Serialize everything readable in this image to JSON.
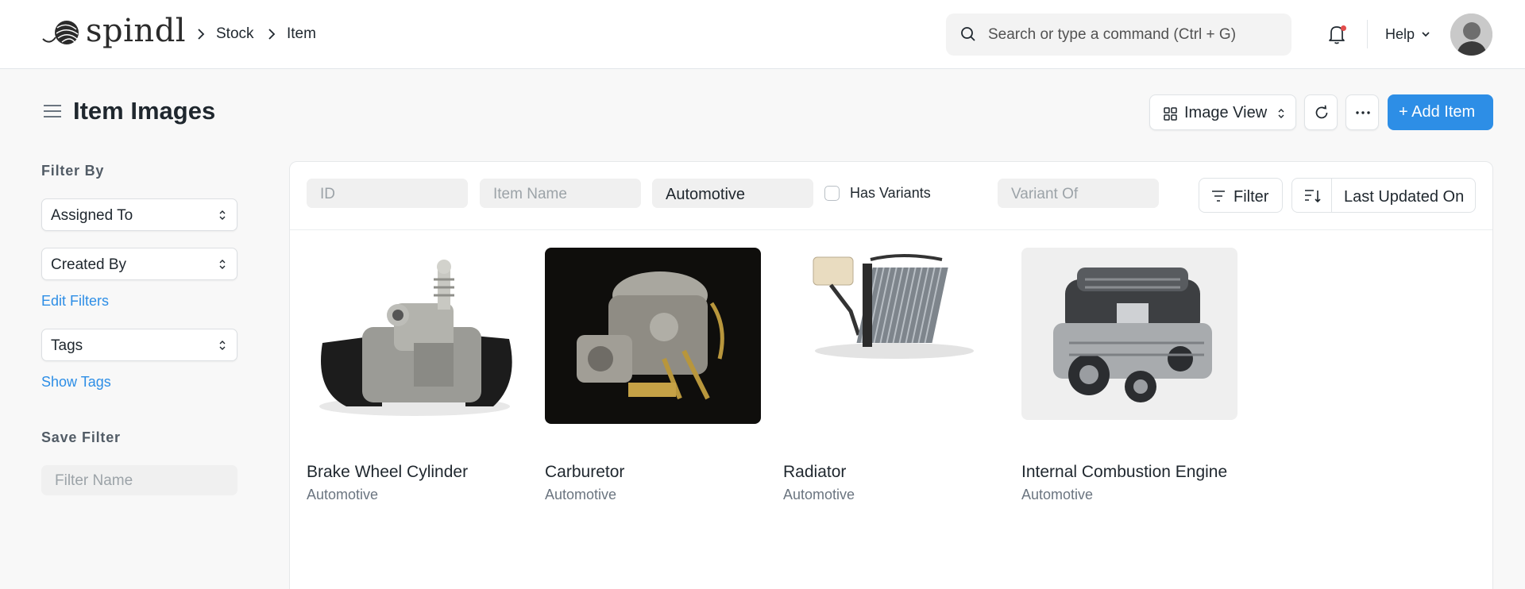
{
  "app": {
    "logo_text": "spindl"
  },
  "breadcrumbs": [
    "Stock",
    "Item"
  ],
  "search": {
    "placeholder": "Search or type a command (Ctrl + G)"
  },
  "navbar": {
    "help_label": "Help"
  },
  "page": {
    "title": "Item Images"
  },
  "toolbar": {
    "view_label": "Image View",
    "add_label": "+ Add Item"
  },
  "sidebar": {
    "filter_by_heading": "Filter By",
    "assigned_to": "Assigned To",
    "created_by": "Created By",
    "edit_filters": "Edit Filters",
    "tags": "Tags",
    "show_tags": "Show Tags",
    "save_filter_heading": "Save Filter",
    "filter_name_placeholder": "Filter Name"
  },
  "filters": {
    "id_placeholder": "ID",
    "item_name_placeholder": "Item Name",
    "item_group_value": "Automotive",
    "has_variants_label": "Has Variants",
    "variant_of_placeholder": "Variant Of",
    "filter_button": "Filter",
    "sort_label": "Last Updated On"
  },
  "items": [
    {
      "name": "Brake Wheel Cylinder",
      "group": "Automotive",
      "image": "brake-wheel-cylinder"
    },
    {
      "name": "Carburetor",
      "group": "Automotive",
      "image": "carburetor"
    },
    {
      "name": "Radiator",
      "group": "Automotive",
      "image": "radiator"
    },
    {
      "name": "Internal Combustion Engine",
      "group": "Automotive",
      "image": "engine"
    }
  ],
  "colors": {
    "primary": "#2d8ee6",
    "text": "#1f272e",
    "muted": "#6b7580",
    "notification_dot": "#e24c4c"
  }
}
